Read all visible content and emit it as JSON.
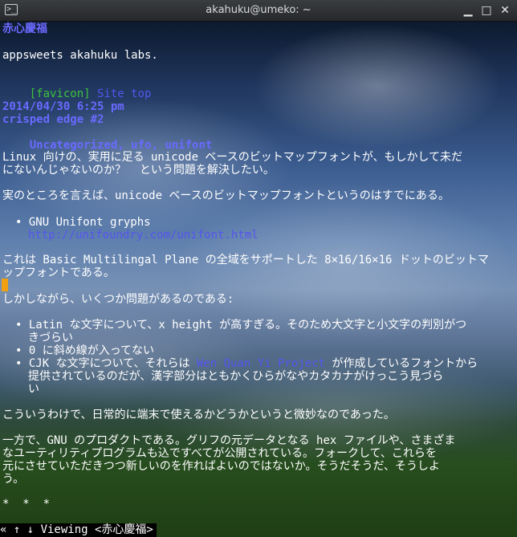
{
  "window": {
    "title": "akahuku@umeko: ~",
    "app_icon": "terminal-icon",
    "minimize": "▁",
    "maximize": "□",
    "close": "✕"
  },
  "page": {
    "site_title": "赤心慶福",
    "tagline": "appsweets akahuku labs.",
    "favicon": "[favicon]",
    "site_top": "Site top",
    "date": "2014/04/30 6:25 pm",
    "post_title": "crisped edge #2",
    "categories": [
      "Uncategorized",
      "ufo",
      "unifont"
    ],
    "sep": ", ",
    "p1_l1": "Linux 向けの、実用に足る unicode ベースのビットマップフォントが、もしかして未だ",
    "p1_l2": "にないんじゃないのか？  という問題を解決したい。",
    "p2": "実のところを言えば、unicode ベースのビットマップフォントというのはすでにある。",
    "li1_text": "GNU Unifont gryphs",
    "li1_link": "http://unifoundry.com/unifont.html",
    "p3_l1": "これは Basic Multilingal Plane の全域をサポートした 8×16/16×16 ドットのビットマ",
    "p3_l2": "ップフォントである。",
    "p4": "しかしながら、いくつか問題があるのである:",
    "li2_l1": "Latin な文字について、x height が高すぎる。そのため大文字と小文字の判別がつ",
    "li2_l2": "きづらい",
    "li3": "0 に斜め線が入ってない",
    "li4_pre": "CJK な文字について、それらは ",
    "li4_link": "Wen Quan Yi Project",
    "li4_post": " が作成しているフォントから",
    "li4_l2": "提供されているのだが、漢字部分はともかくひらがなやカタカナがけっこう見づら",
    "li4_l3": "い",
    "p5": "こういうわけで、日常的に端末で使えるかどうかというと微妙なのであった。",
    "p6_l1": "一方で、GNU のプロダクトである。グリフの元データとなる hex ファイルや、さまざま",
    "p6_l2": "なユーティリティプログラムも込ですべてが公開されている。フォークして、これらを",
    "p6_l3": "元にさせていただきつつ新しいのを作ればよいのではないか。そうだそうだ、そうしよ",
    "p6_l4": "う。",
    "stars": "*  *  *",
    "bullet": "•"
  },
  "status": {
    "text": "« ↑ ↓ Viewing <赤心慶福>"
  }
}
